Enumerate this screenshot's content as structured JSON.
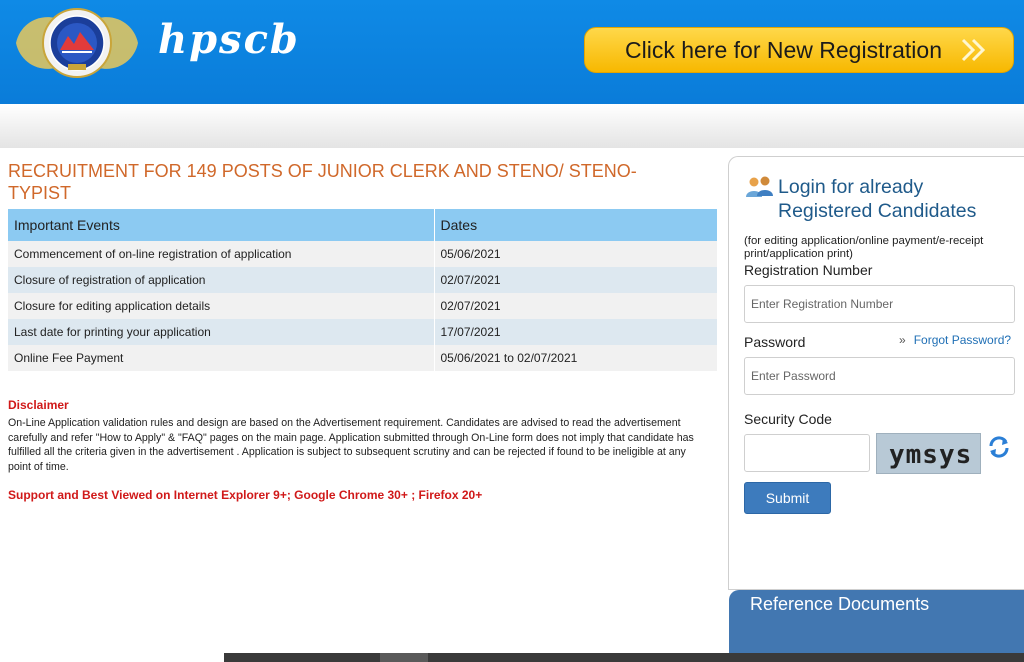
{
  "header": {
    "brand": "hpscb",
    "new_registration_label": "Click here for New Registration"
  },
  "main": {
    "title": "RECRUITMENT FOR 149 POSTS OF JUNIOR CLERK AND STENO/ STENO-TYPIST",
    "table": {
      "headers": [
        "Important Events",
        "Dates"
      ],
      "rows": [
        [
          "Commencement of on-line registration of application",
          "05/06/2021"
        ],
        [
          "Closure of registration of application",
          "02/07/2021"
        ],
        [
          "Closure for editing application details",
          "02/07/2021"
        ],
        [
          "Last date for printing your application",
          "17/07/2021"
        ],
        [
          "Online Fee Payment",
          "05/06/2021 to 02/07/2021"
        ]
      ]
    },
    "disclaimer_heading": "Disclaimer",
    "disclaimer_text": "On-Line Application validation rules and design are based on the Advertisement requirement. Candidates are advised to read the advertisement carefully and refer \"How to Apply\" & \"FAQ\" pages on the main page. Application submitted through On-Line form does not imply that candidate has fulfilled all the criteria given in the advertisement . Application is subject to subsequent scrutiny and can be rejected if found to be ineligible at any point of time.",
    "support_text": "Support and Best Viewed on Internet Explorer 9+; Google Chrome 30+ ; Firefox 20+"
  },
  "login": {
    "heading_line1": "Login for already",
    "heading_line2": "Registered Candidates",
    "note": "(for editing application/online payment/e-receipt print/application print)",
    "reg_label": "Registration Number",
    "reg_placeholder": "Enter Registration Number",
    "password_label": "Password",
    "forgot_label": "Forgot Password?",
    "password_placeholder": "Enter Password",
    "security_label": "Security Code",
    "captcha_text": "ymsys",
    "submit_label": "Submit"
  },
  "reference": {
    "title": "Reference Documents"
  },
  "colors": {
    "header_blue": "#0f8ae6",
    "title_orange": "#d0682a",
    "table_header": "#8ccaf2",
    "disclaimer_red": "#d01919",
    "login_heading": "#1f5a8a",
    "submit_blue": "#3d7bbd",
    "cta_yellow": "#f7b800"
  }
}
